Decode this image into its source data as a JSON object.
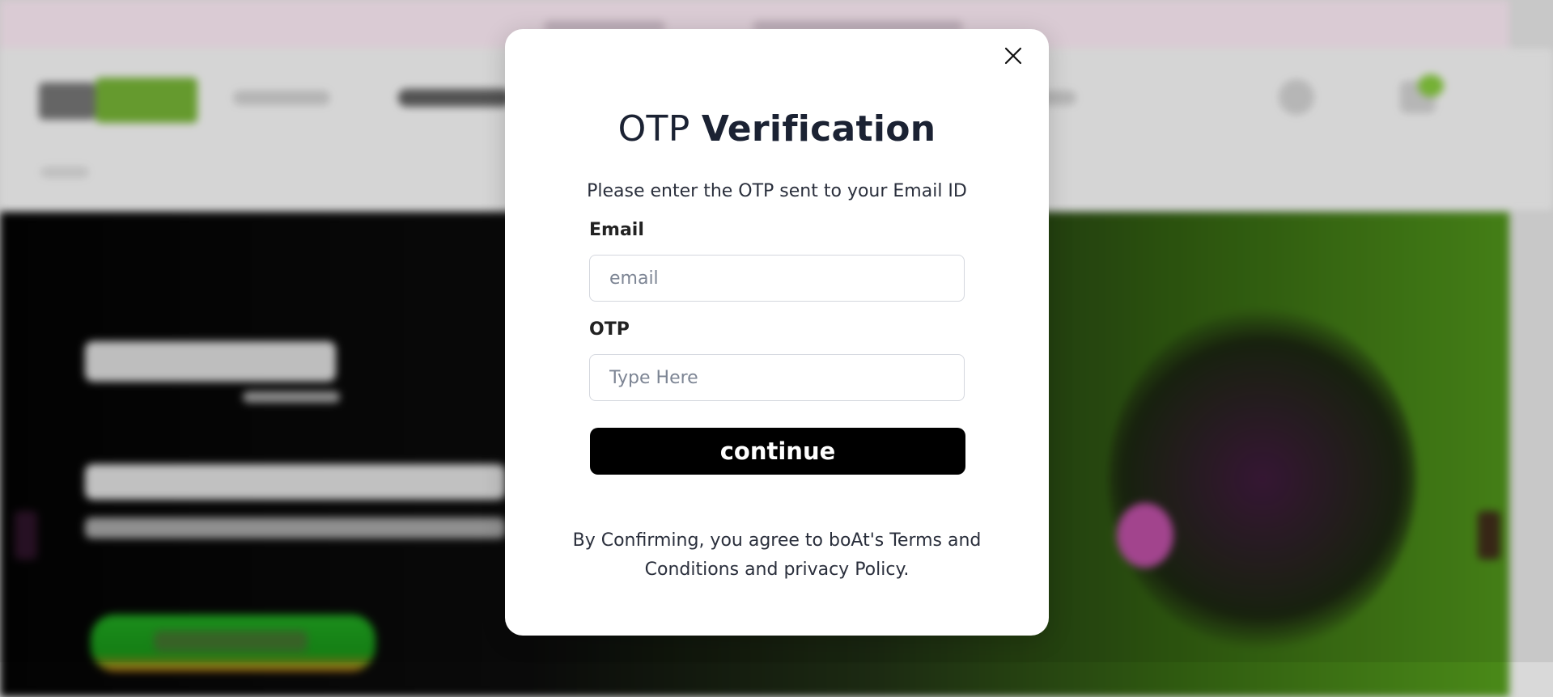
{
  "modal": {
    "close_icon": "close-icon",
    "title_part1": "OTP",
    "title_part2": "Verification",
    "subtitle": "Please enter the OTP sent to your Email ID",
    "email_label": "Email",
    "email_placeholder": "email",
    "email_value": "",
    "otp_label": "OTP",
    "otp_placeholder": "Type Here",
    "otp_value": "",
    "continue_label": "continue",
    "legal_line1": "By Confirming, you agree to boAt's Terms and",
    "legal_line2": "Conditions and privacy Policy."
  },
  "colors": {
    "title": "#1b2233",
    "button_bg": "#000000",
    "button_text": "#ffffff",
    "field_border": "#d4d7de",
    "placeholder": "#7d8594"
  }
}
